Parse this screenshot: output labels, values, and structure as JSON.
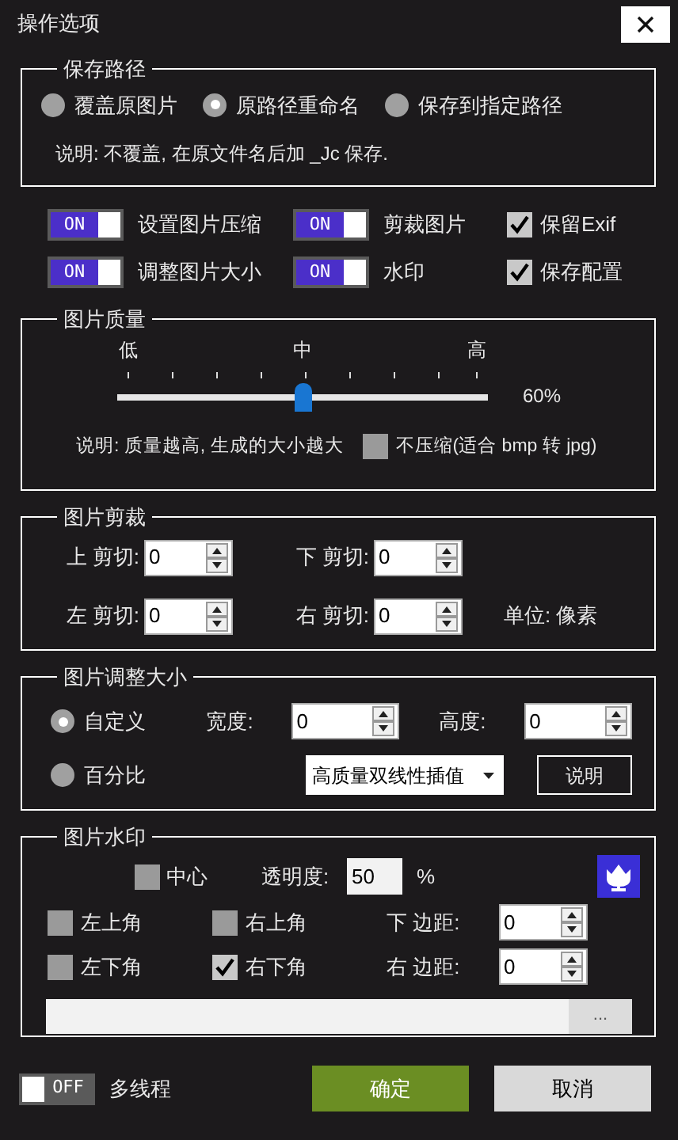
{
  "window": {
    "title": "操作选项"
  },
  "save_path": {
    "title": "保存路径",
    "options": [
      {
        "label": "覆盖原图片",
        "selected": false
      },
      {
        "label": "原路径重命名",
        "selected": true
      },
      {
        "label": "保存到指定路径",
        "selected": false
      }
    ],
    "note": "说明: 不覆盖, 在原文件名后加 _Jc 保存."
  },
  "features": [
    {
      "kind": "toggle",
      "label": "设置图片压缩",
      "on": true,
      "toggle_text": "ON"
    },
    {
      "kind": "toggle",
      "label": "剪裁图片",
      "on": true,
      "toggle_text": "ON"
    },
    {
      "kind": "checkbox",
      "label": "保留Exif",
      "checked": true
    },
    {
      "kind": "toggle",
      "label": "调整图片大小",
      "on": true,
      "toggle_text": "ON"
    },
    {
      "kind": "toggle",
      "label": "水印",
      "on": true,
      "toggle_text": "ON"
    },
    {
      "kind": "checkbox",
      "label": "保存配置",
      "checked": true
    }
  ],
  "quality": {
    "title": "图片质量",
    "scale_labels": [
      "低",
      "中",
      "高"
    ],
    "slider": {
      "level": 0.5,
      "reading": "60%"
    },
    "note": "说明: 质量越高, 生成的大小越大",
    "no_compress": {
      "label": "不压缩(适合 bmp 转 jpg)",
      "checked": false
    }
  },
  "crop": {
    "title": "图片剪裁",
    "fields": [
      {
        "label": "上 剪切:",
        "value": "0"
      },
      {
        "label": "下 剪切:",
        "value": "0"
      },
      {
        "label": "左 剪切:",
        "value": "0"
      },
      {
        "label": "右 剪切:",
        "value": "0"
      }
    ],
    "unit": "单位: 像素"
  },
  "resize": {
    "title": "图片调整大小",
    "modes": [
      {
        "label": "自定义",
        "selected": true
      },
      {
        "label": "百分比",
        "selected": false
      }
    ],
    "width": {
      "label": "宽度:",
      "value": "0"
    },
    "height": {
      "label": "高度:",
      "value": "0"
    },
    "interpolation": "高质量双线性插值",
    "help_button": "说明"
  },
  "watermark": {
    "title": "图片水印",
    "center": {
      "label": "中心",
      "checked": false
    },
    "opacity": {
      "label": "透明度:",
      "value": "50",
      "unit": "%"
    },
    "corners": [
      {
        "label": "左上角",
        "checked": false
      },
      {
        "label": "右上角",
        "checked": false
      },
      {
        "label": "左下角",
        "checked": false
      },
      {
        "label": "右下角",
        "checked": true
      }
    ],
    "margins": [
      {
        "label": "下 边距:",
        "value": "0"
      },
      {
        "label": "右 边距:",
        "value": "0"
      }
    ],
    "browse_button": "..."
  },
  "multithread": {
    "label": "多线程",
    "on": false,
    "toggle_text": "OFF"
  },
  "buttons": [
    {
      "kind": "primary",
      "label": "确定"
    },
    {
      "kind": "secondary",
      "label": "取消"
    }
  ]
}
